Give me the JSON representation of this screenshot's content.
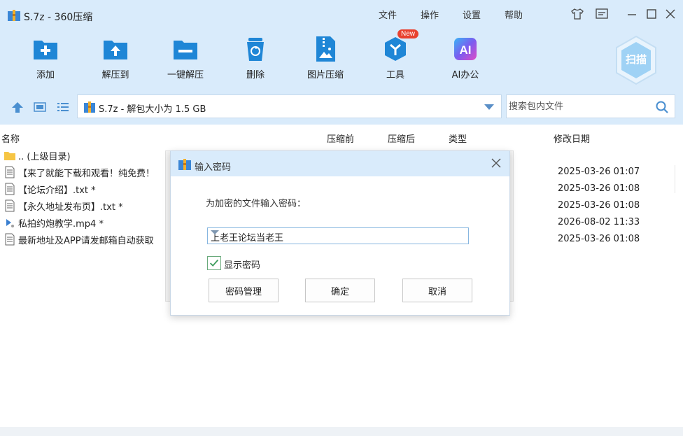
{
  "window": {
    "title": "S.7z - 360压缩",
    "menus": [
      "文件",
      "操作",
      "设置",
      "帮助"
    ]
  },
  "toolbar": {
    "items": [
      {
        "label": "添加",
        "icon": "add-icon"
      },
      {
        "label": "解压到",
        "icon": "extract-to-icon"
      },
      {
        "label": "一键解压",
        "icon": "one-click-extract-icon"
      },
      {
        "label": "删除",
        "icon": "delete-icon"
      },
      {
        "label": "图片压缩",
        "icon": "image-compress-icon"
      },
      {
        "label": "工具",
        "icon": "tools-icon"
      },
      {
        "label": "AI办公",
        "icon": "ai-office-icon"
      }
    ],
    "new_badge": "New",
    "scan_label": "扫描"
  },
  "address": {
    "path": "S.7z - 解包大小为 1.5 GB",
    "search_placeholder": "搜索包内文件"
  },
  "columns": {
    "name": "名称",
    "before": "压缩前",
    "after": "压缩后",
    "type": "类型",
    "modified": "修改日期"
  },
  "files": [
    {
      "name": ".. (上级目录)",
      "date": "",
      "kind": "folder"
    },
    {
      "name": "【来了就能下载和观看！纯免费！",
      "date": "2025-03-26 01:07",
      "kind": "text"
    },
    {
      "name": "【论坛介绍】.txt *",
      "date": "2025-03-26 01:08",
      "kind": "text"
    },
    {
      "name": "【永久地址发布页】.txt *",
      "date": "2025-03-26 01:08",
      "kind": "text"
    },
    {
      "name": "私拍约炮教学.mp4 *",
      "date": "2026-08-02 11:33",
      "kind": "video"
    },
    {
      "name": "最新地址及APP请发邮箱自动获取",
      "date": "2025-03-26 01:08",
      "kind": "text"
    }
  ],
  "dialog": {
    "title": "输入密码",
    "prompt": "为加密的文件输入密码：",
    "password": "上老王论坛当老王",
    "show_password_label": "显示密码",
    "show_password_checked": true,
    "buttons": {
      "manage": "密码管理",
      "ok": "确定",
      "cancel": "取消"
    }
  },
  "colors": {
    "chrome": "#d9ebfb",
    "accent": "#1f86d6"
  }
}
